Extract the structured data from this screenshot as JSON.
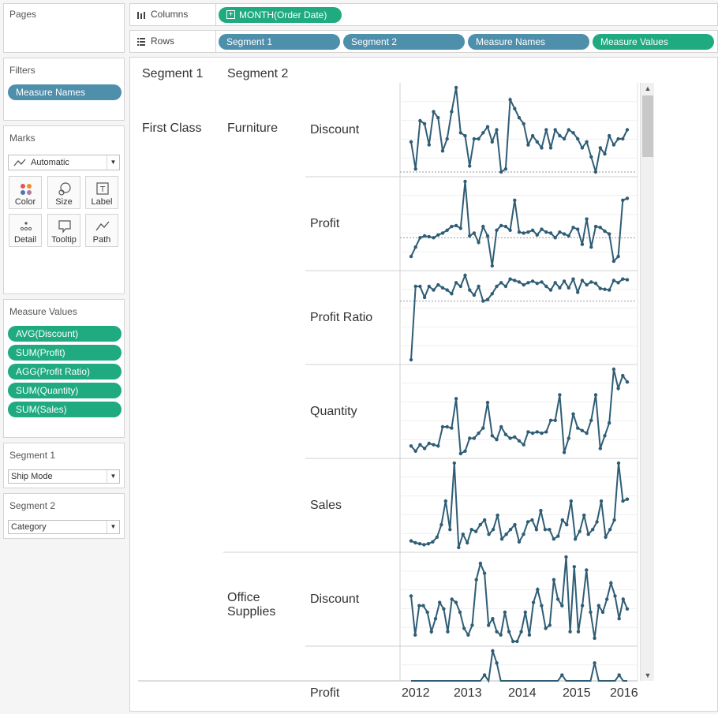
{
  "sidebar": {
    "pages": {
      "title": "Pages"
    },
    "filters": {
      "title": "Filters",
      "pills": [
        "Measure Names"
      ]
    },
    "marks": {
      "title": "Marks",
      "type": "Automatic",
      "buttons": [
        "Color",
        "Size",
        "Label",
        "Detail",
        "Tooltip",
        "Path"
      ]
    },
    "measure_values": {
      "title": "Measure Values",
      "pills": [
        "AVG(Discount)",
        "SUM(Profit)",
        "AGG(Profit Ratio)",
        "SUM(Quantity)",
        "SUM(Sales)"
      ]
    },
    "segment1": {
      "title": "Segment 1",
      "value": "Ship Mode"
    },
    "segment2": {
      "title": "Segment 2",
      "value": "Category"
    }
  },
  "shelves": {
    "columns": {
      "label": "Columns",
      "pills": [
        "MONTH(Order Date)"
      ]
    },
    "rows": {
      "label": "Rows",
      "pills": [
        "Segment 1",
        "Segment 2",
        "Measure Names",
        "Measure Values"
      ]
    }
  },
  "view": {
    "col_headers": {
      "segment1": "Segment 1",
      "segment2": "Segment 2"
    },
    "segment1_value": "First Class",
    "segment2_values": [
      "Furniture",
      "Office Supplies"
    ],
    "x_ticks": [
      "2012",
      "2013",
      "2014",
      "2015",
      "2016"
    ]
  },
  "colors": {
    "blue_pill": "#4e8fab",
    "green_pill": "#1faa7f",
    "line": "#2f5d75"
  },
  "chart_data": {
    "type": "line",
    "x": "MONTH(Order Date)",
    "x_ticks": [
      "2012",
      "2013",
      "2014",
      "2015",
      "2016"
    ],
    "panels": [
      {
        "segment1": "First Class",
        "segment2": "Furniture",
        "measure": "Discount",
        "values": [
          0.12,
          0.03,
          0.19,
          0.18,
          0.11,
          0.22,
          0.2,
          0.09,
          0.13,
          0.22,
          0.3,
          0.15,
          0.14,
          0.04,
          0.13,
          0.13,
          0.15,
          0.17,
          0.12,
          0.16,
          0.02,
          0.03,
          0.26,
          0.23,
          0.2,
          0.18,
          0.11,
          0.14,
          0.12,
          0.1,
          0.16,
          0.1,
          0.16,
          0.14,
          0.13,
          0.16,
          0.15,
          0.13,
          0.1,
          0.12,
          0.07,
          0.02,
          0.1,
          0.08,
          0.14,
          0.11,
          0.13,
          0.13,
          0.16
        ]
      },
      {
        "segment1": "First Class",
        "segment2": "Furniture",
        "measure": "Profit",
        "values": [
          -200,
          -100,
          0,
          20,
          10,
          0,
          30,
          50,
          80,
          120,
          130,
          100,
          600,
          20,
          50,
          -50,
          120,
          20,
          -300,
          80,
          130,
          120,
          80,
          400,
          60,
          50,
          60,
          80,
          30,
          90,
          60,
          50,
          0,
          60,
          40,
          20,
          110,
          90,
          -70,
          200,
          -100,
          120,
          110,
          70,
          40,
          -250,
          -200,
          400,
          420
        ]
      },
      {
        "segment1": "First Class",
        "segment2": "Furniture",
        "measure": "Profit Ratio",
        "values": [
          -0.8,
          0.2,
          0.2,
          0.05,
          0.2,
          0.15,
          0.22,
          0.18,
          0.15,
          0.1,
          0.25,
          0.2,
          0.35,
          0.15,
          0.08,
          0.2,
          0.0,
          0.02,
          0.1,
          0.2,
          0.25,
          0.2,
          0.3,
          0.28,
          0.26,
          0.22,
          0.25,
          0.27,
          0.24,
          0.26,
          0.2,
          0.15,
          0.25,
          0.18,
          0.27,
          0.18,
          0.3,
          0.12,
          0.28,
          0.22,
          0.26,
          0.24,
          0.17,
          0.16,
          0.15,
          0.28,
          0.25,
          0.3,
          0.29
        ]
      },
      {
        "segment1": "First Class",
        "segment2": "Furniture",
        "measure": "Quantity",
        "values": [
          10,
          6,
          11,
          8,
          12,
          11,
          10,
          25,
          25,
          24,
          47,
          4,
          6,
          16,
          16,
          20,
          24,
          44,
          18,
          15,
          25,
          19,
          16,
          17,
          14,
          11,
          21,
          20,
          21,
          20,
          21,
          30,
          30,
          50,
          5,
          16,
          35,
          24,
          22,
          20,
          30,
          50,
          8,
          18,
          28,
          70,
          55,
          65,
          60
        ]
      },
      {
        "segment1": "First Class",
        "segment2": "Furniture",
        "measure": "Sales",
        "values": [
          800,
          600,
          500,
          400,
          500,
          700,
          1200,
          2500,
          5000,
          2000,
          9000,
          100,
          1500,
          600,
          2000,
          1800,
          2500,
          3000,
          1500,
          2000,
          3500,
          1000,
          1500,
          2000,
          2500,
          700,
          1500,
          2800,
          3000,
          2000,
          4000,
          2000,
          2000,
          1000,
          1300,
          3000,
          2500,
          5000,
          1000,
          1800,
          3500,
          1500,
          2000,
          2800,
          5000,
          1200,
          2000,
          3000,
          9000,
          5000,
          5200
        ]
      },
      {
        "segment1": "First Class",
        "segment2": "Office Supplies",
        "measure": "Discount",
        "values": [
          0.15,
          0.03,
          0.12,
          0.12,
          0.1,
          0.04,
          0.08,
          0.13,
          0.11,
          0.04,
          0.14,
          0.13,
          0.1,
          0.05,
          0.03,
          0.06,
          0.2,
          0.25,
          0.22,
          0.06,
          0.08,
          0.04,
          0.03,
          0.1,
          0.04,
          0.01,
          0.01,
          0.04,
          0.1,
          0.03,
          0.13,
          0.17,
          0.12,
          0.05,
          0.06,
          0.2,
          0.14,
          0.12,
          0.27,
          0.04,
          0.24,
          0.04,
          0.12,
          0.23,
          0.1,
          0.02,
          0.12,
          0.1,
          0.14,
          0.19,
          0.15,
          0.08,
          0.14,
          0.11
        ]
      },
      {
        "segment1": "First Class",
        "segment2": "Office Supplies",
        "measure": "Profit",
        "values": [
          0,
          0,
          0,
          0,
          0,
          0,
          0,
          0,
          0,
          0,
          0,
          0,
          0,
          0,
          0,
          400,
          400,
          300,
          500,
          200,
          700,
          600,
          300,
          400,
          0,
          200,
          0,
          0,
          0,
          0,
          200,
          100,
          0,
          0,
          300,
          200,
          0,
          500,
          0,
          0,
          0,
          0,
          100,
          0,
          300,
          600,
          0,
          0,
          0,
          0,
          0,
          500,
          0,
          0
        ]
      }
    ]
  }
}
